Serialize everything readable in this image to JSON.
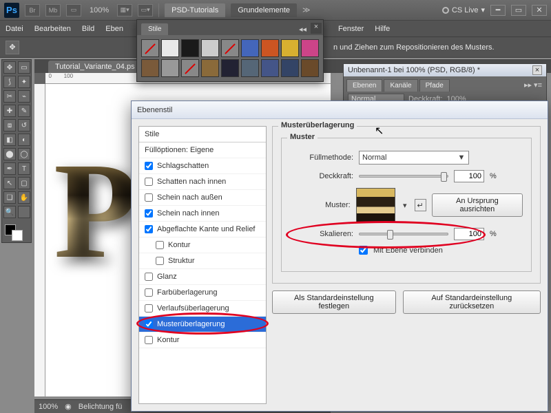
{
  "appbar": {
    "zoom": "100%",
    "tab1": "PSD-Tutorials",
    "tab2": "Grundelemente",
    "cslive": "CS Live"
  },
  "menu": {
    "datei": "Datei",
    "bearbeiten": "Bearbeiten",
    "bild": "Bild",
    "ebene": "Eben",
    "fenster": "Fenster",
    "hilfe": "Hilfe"
  },
  "optbar": {
    "hint": "n und Ziehen zum Repositionieren des Musters."
  },
  "doctab": "Tutorial_Variante_04.ps",
  "canvas": {
    "letter": "P"
  },
  "status": {
    "zoom": "100%",
    "info": "Belichtung fü"
  },
  "stile": {
    "title": "Stile"
  },
  "rightdoc": {
    "title": "Unbenannt-1 bei 100% (PSD, RGB/8) *",
    "tabs": [
      "Ebenen",
      "Kanäle",
      "Pfade"
    ],
    "mode": "Normal",
    "opacityLabel": "Deckkraft:",
    "opacity": "100%"
  },
  "dialog": {
    "title": "Ebenenstil",
    "list": {
      "header": "Stile",
      "fillopt": "Füllöptionen: Eigene",
      "items": [
        {
          "label": "Schlagschatten",
          "checked": true
        },
        {
          "label": "Schatten nach innen",
          "checked": false
        },
        {
          "label": "Schein nach außen",
          "checked": false
        },
        {
          "label": "Schein nach innen",
          "checked": true
        },
        {
          "label": "Abgeflachte Kante und Relief",
          "checked": true
        },
        {
          "label": "Kontur",
          "checked": false,
          "sub": true
        },
        {
          "label": "Struktur",
          "checked": false,
          "sub": true
        },
        {
          "label": "Glanz",
          "checked": false
        },
        {
          "label": "Farbüberlagerung",
          "checked": false
        },
        {
          "label": "Verlaufsüberlagerung",
          "checked": false
        },
        {
          "label": "Musterüberlagerung",
          "checked": true,
          "selected": true
        },
        {
          "label": "Kontur",
          "checked": false
        }
      ]
    },
    "section": {
      "outer": "Musterüberlagerung",
      "inner": "Muster"
    },
    "fields": {
      "blendLabel": "Füllmethode:",
      "blendValue": "Normal",
      "opacityLabel": "Deckkraft:",
      "opacityValue": "100",
      "pct": "%",
      "patternLabel": "Muster:",
      "originBtn": "An Ursprung ausrichten",
      "scaleLabel": "Skalieren:",
      "scaleValue": "100",
      "linkLabel": "Mit Ebene verbinden",
      "linkChecked": true
    },
    "buttons": {
      "default": "Als Standardeinstellung festlegen",
      "reset": "Auf Standardeinstellung zurücksetzen"
    }
  }
}
